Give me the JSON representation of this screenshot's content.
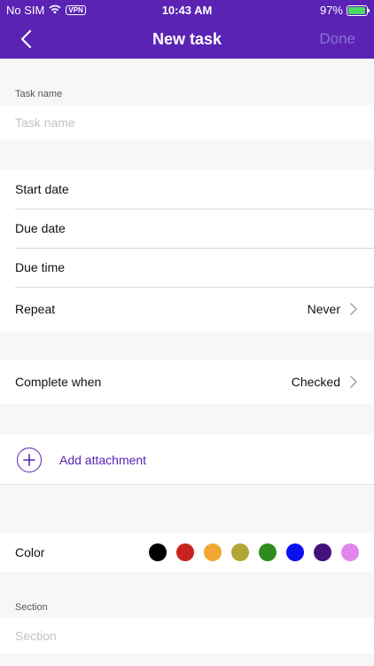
{
  "status": {
    "carrier": "No SIM",
    "vpn": "VPN",
    "time": "10:43 AM",
    "battery": "97%",
    "battery_level": 0.97
  },
  "nav": {
    "title": "New task",
    "done": "Done"
  },
  "task_name": {
    "label": "Task name",
    "placeholder": "Task name"
  },
  "dates": {
    "start": "Start date",
    "due": "Due date",
    "due_time": "Due time",
    "repeat": "Repeat",
    "repeat_value": "Never"
  },
  "complete": {
    "label": "Complete when",
    "value": "Checked"
  },
  "attachment": {
    "label": "Add attachment"
  },
  "color": {
    "label": "Color",
    "swatches": [
      "#000000",
      "#c8231e",
      "#f0a830",
      "#b4a636",
      "#2e8b1e",
      "#0a10f0",
      "#45107c",
      "#e285ec"
    ]
  },
  "section": {
    "label": "Section",
    "placeholder": "Section"
  }
}
